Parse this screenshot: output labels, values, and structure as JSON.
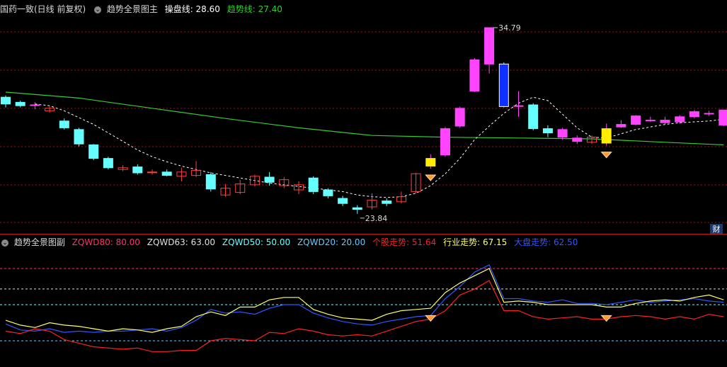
{
  "main_panel": {
    "stock_title": "国药一致(日线 前复权)",
    "indicator_name": "趋势全景图主",
    "ma_label": "操盘线: 28.60",
    "trend_label": "趋势线: 27.40",
    "high_label": "34.79",
    "low_label": "23.84",
    "finance_badge": "财"
  },
  "sub_panel": {
    "indicator_name": "趋势全景图副",
    "labels": [
      {
        "text": "ZQWD80: 80.00",
        "color": "#ff3366"
      },
      {
        "text": "ZQWD63: 63.00",
        "color": "#e0e0e0"
      },
      {
        "text": "ZQWD50: 50.00",
        "color": "#66ffff"
      },
      {
        "text": "ZQWD20: 20.00",
        "color": "#66c8ff"
      },
      {
        "text": "个股走势: 51.64",
        "color": "#ff2020"
      },
      {
        "text": "行业走势: 67.15",
        "color": "#ffff66"
      },
      {
        "text": "大盘走势: 62.50",
        "color": "#3355ff"
      }
    ]
  },
  "colors": {
    "up": "#ff44ff",
    "down": "#66ffff",
    "grid": "#a01010",
    "trend_line": "#33cc33",
    "ma_line": "#ffffff",
    "stock_line": "#ff2020",
    "industry_line": "#ffff66",
    "market_line": "#3355ff",
    "highlight_yellow": "#ffee00",
    "highlight_blue": "#1030ff"
  },
  "chart_data": {
    "type": "candlestick",
    "price_range": [
      23.0,
      35.5
    ],
    "candles": [
      {
        "o": 30.7,
        "c": 30.3,
        "h": 30.8,
        "l": 30.1
      },
      {
        "o": 30.4,
        "c": 30.2,
        "h": 30.5,
        "l": 30.1
      },
      {
        "o": 30.25,
        "c": 30.25,
        "h": 30.4,
        "l": 30.0
      },
      {
        "o": 29.9,
        "c": 30.05,
        "h": 30.15,
        "l": 29.8,
        "style": "hollow"
      },
      {
        "o": 29.3,
        "c": 28.9,
        "h": 29.45,
        "l": 28.8
      },
      {
        "o": 28.8,
        "c": 27.95,
        "h": 28.9,
        "l": 27.8
      },
      {
        "o": 27.9,
        "c": 27.1,
        "h": 27.95,
        "l": 27.0
      },
      {
        "o": 27.1,
        "c": 26.55,
        "h": 27.2,
        "l": 26.45
      },
      {
        "o": 26.45,
        "c": 26.55,
        "h": 26.7,
        "l": 26.35,
        "style": "hollow"
      },
      {
        "o": 26.6,
        "c": 26.25,
        "h": 26.75,
        "l": 26.15
      },
      {
        "o": 26.3,
        "c": 26.3,
        "h": 26.45,
        "l": 26.15,
        "style": "hollow"
      },
      {
        "o": 26.3,
        "c": 26.1,
        "h": 26.45,
        "l": 26.05
      },
      {
        "o": 26.05,
        "c": 26.3,
        "h": 26.55,
        "l": 25.75,
        "style": "hollow"
      },
      {
        "o": 26.1,
        "c": 26.4,
        "h": 26.95,
        "l": 26.0,
        "style": "hollow"
      },
      {
        "o": 26.15,
        "c": 25.3,
        "h": 26.3,
        "l": 25.15
      },
      {
        "o": 24.95,
        "c": 25.35,
        "h": 25.6,
        "l": 24.85,
        "style": "hollow"
      },
      {
        "o": 25.1,
        "c": 25.6,
        "h": 25.85,
        "l": 25.0,
        "style": "hollow"
      },
      {
        "o": 25.55,
        "c": 26.05,
        "h": 26.15,
        "l": 25.45,
        "style": "hollow"
      },
      {
        "o": 26.0,
        "c": 25.7,
        "h": 26.3,
        "l": 25.5
      },
      {
        "o": 25.5,
        "c": 25.85,
        "h": 26.0,
        "l": 25.35,
        "style": "hollow"
      },
      {
        "o": 25.25,
        "c": 25.55,
        "h": 25.75,
        "l": 25.0,
        "style": "hollow"
      },
      {
        "o": 25.95,
        "c": 25.15,
        "h": 26.05,
        "l": 25.0
      },
      {
        "o": 25.25,
        "c": 24.9,
        "h": 25.35,
        "l": 24.75
      },
      {
        "o": 24.75,
        "c": 24.45,
        "h": 24.9,
        "l": 24.3
      },
      {
        "o": 24.2,
        "c": 24.1,
        "h": 24.35,
        "l": 23.84
      },
      {
        "o": 24.25,
        "c": 24.65,
        "h": 25.05,
        "l": 24.1,
        "style": "hollow"
      },
      {
        "o": 24.6,
        "c": 24.45,
        "h": 24.75,
        "l": 24.3
      },
      {
        "o": 24.55,
        "c": 24.85,
        "h": 25.15,
        "l": 24.45,
        "style": "hollow"
      },
      {
        "o": 25.15,
        "c": 26.2,
        "h": 26.25,
        "l": 25.05,
        "style": "hollow"
      },
      {
        "o": 26.65,
        "c": 27.1,
        "h": 27.35,
        "l": 26.5,
        "style": "yellow"
      },
      {
        "o": 27.3,
        "c": 28.85,
        "h": 28.95,
        "l": 27.2
      },
      {
        "o": 29.0,
        "c": 30.05,
        "h": 30.15,
        "l": 28.9
      },
      {
        "o": 31.05,
        "c": 32.9,
        "h": 33.0,
        "l": 31.0
      },
      {
        "o": 32.65,
        "c": 34.79,
        "h": 34.79,
        "l": 32.1
      },
      {
        "o": 32.65,
        "c": 30.15,
        "h": 32.75,
        "l": 30.1,
        "style": "blue"
      },
      {
        "o": 30.2,
        "c": 30.2,
        "h": 31.05,
        "l": 29.55
      },
      {
        "o": 30.25,
        "c": 28.85,
        "h": 30.35,
        "l": 28.75
      },
      {
        "o": 28.85,
        "c": 28.6,
        "h": 29.05,
        "l": 28.35
      },
      {
        "o": 28.35,
        "c": 28.8,
        "h": 28.9,
        "l": 28.2
      },
      {
        "o": 28.1,
        "c": 28.3,
        "h": 28.45,
        "l": 27.95
      },
      {
        "o": 28.05,
        "c": 28.35,
        "h": 28.45,
        "l": 27.95,
        "style": "hollow"
      },
      {
        "o": 28.0,
        "c": 28.85,
        "h": 29.15,
        "l": 27.85,
        "style": "yellow"
      },
      {
        "o": 28.95,
        "c": 29.1,
        "h": 29.35,
        "l": 28.9
      },
      {
        "o": 29.1,
        "c": 29.6,
        "h": 29.65,
        "l": 29.05
      },
      {
        "o": 29.35,
        "c": 29.35,
        "h": 29.55,
        "l": 29.25
      },
      {
        "o": 29.2,
        "c": 29.35,
        "h": 29.55,
        "l": 29.1
      },
      {
        "o": 29.25,
        "c": 29.55,
        "h": 29.65,
        "l": 29.15
      },
      {
        "o": 29.55,
        "c": 29.85,
        "h": 29.95,
        "l": 29.45
      },
      {
        "o": 29.75,
        "c": 29.75,
        "h": 29.9,
        "l": 29.6
      },
      {
        "o": 29.05,
        "c": 29.95,
        "h": 29.95,
        "l": 29.0
      }
    ],
    "ma_line": [
      null,
      null,
      30.3,
      30.2,
      29.9,
      29.5,
      29.1,
      28.6,
      28.1,
      27.6,
      27.2,
      26.9,
      26.65,
      26.45,
      26.25,
      26.1,
      25.95,
      25.8,
      25.65,
      25.55,
      25.45,
      25.35,
      25.25,
      25.15,
      24.95,
      24.85,
      24.8,
      24.85,
      25.05,
      25.5,
      26.2,
      27.1,
      28.2,
      29.0,
      29.75,
      30.35,
      30.7,
      30.5,
      29.7,
      28.9,
      28.35,
      28.3,
      28.55,
      28.8,
      28.95,
      29.1,
      29.2,
      29.25,
      29.3,
      29.4
    ],
    "trend_line_points": [
      [
        0,
        31.0
      ],
      [
        5,
        30.65
      ],
      [
        10,
        30.05
      ],
      [
        15,
        29.45
      ],
      [
        20,
        28.9
      ],
      [
        25,
        28.45
      ],
      [
        30,
        28.35
      ],
      [
        35,
        28.3
      ],
      [
        40,
        28.25
      ],
      [
        45,
        28.05
      ],
      [
        49,
        27.9
      ]
    ],
    "sub_chart": {
      "y_range": [
        0,
        100
      ],
      "reference_lines": [
        80,
        63,
        50,
        20
      ],
      "stock": [
        28,
        26,
        30,
        28,
        21,
        18,
        15,
        14,
        13,
        14,
        11,
        11,
        12,
        12,
        20,
        22,
        21,
        20,
        27,
        26,
        30,
        28,
        25,
        24,
        25,
        24,
        28,
        32,
        36,
        38,
        45,
        58,
        63,
        70,
        45,
        45,
        40,
        38,
        39,
        40,
        38,
        38,
        40,
        41,
        40,
        38,
        40,
        38,
        42,
        40
      ],
      "industry": [
        37,
        33,
        31,
        35,
        33,
        32,
        30,
        28,
        30,
        29,
        27,
        30,
        32,
        40,
        44,
        41,
        48,
        48,
        54,
        56,
        56,
        46,
        42,
        39,
        38,
        37,
        42,
        45,
        46,
        47,
        60,
        68,
        74,
        80,
        52,
        53,
        52,
        50,
        50,
        50,
        50,
        48,
        48,
        51,
        53,
        54,
        53,
        56,
        58,
        54
      ],
      "market": [
        34,
        29,
        28,
        30,
        27,
        28,
        27,
        28,
        28,
        29,
        30,
        28,
        31,
        37,
        46,
        43,
        44,
        42,
        47,
        50,
        50,
        43,
        39,
        36,
        34,
        33,
        36,
        38,
        40,
        41,
        55,
        65,
        77,
        83,
        55,
        55,
        53,
        52,
        54,
        51,
        51,
        50,
        52,
        54,
        52,
        53,
        54,
        55,
        53,
        52
      ]
    }
  }
}
